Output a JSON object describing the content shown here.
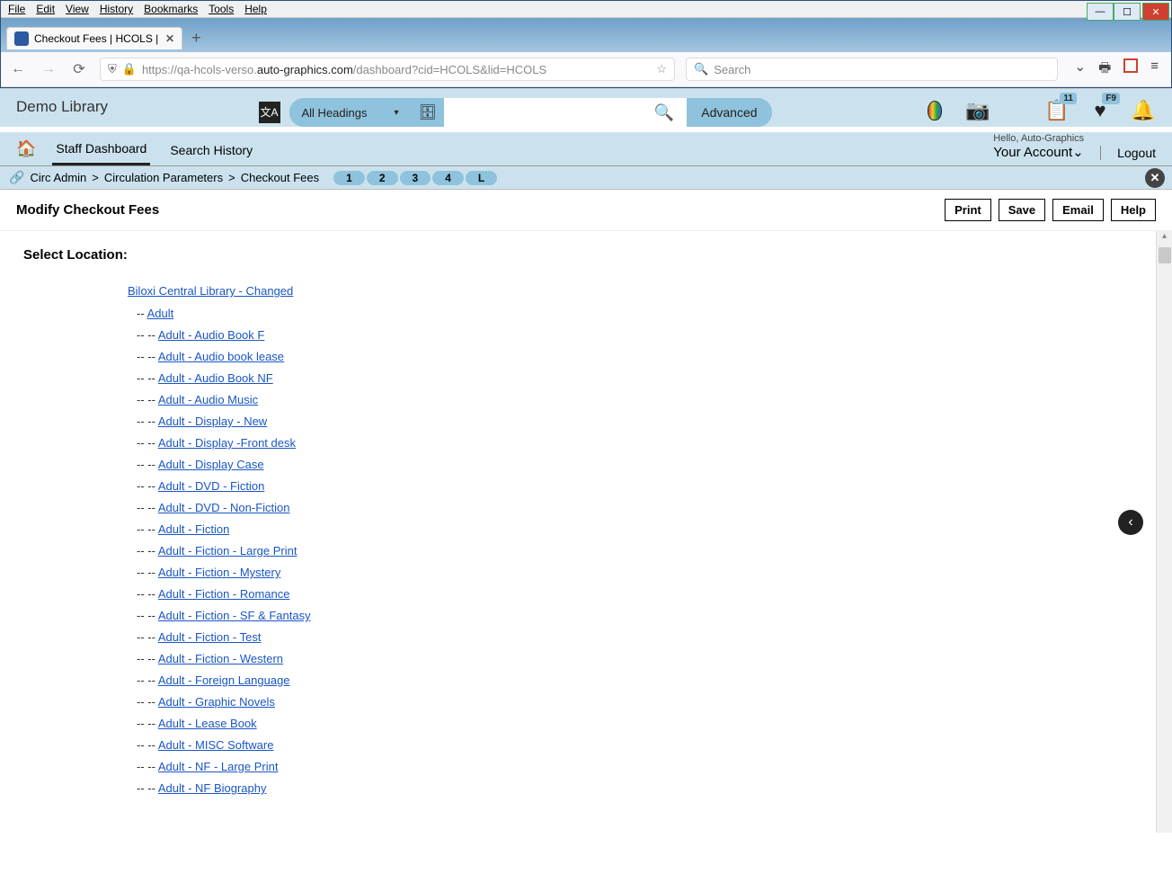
{
  "menubar": [
    "File",
    "Edit",
    "View",
    "History",
    "Bookmarks",
    "Tools",
    "Help"
  ],
  "tab": {
    "title": "Checkout Fees | HCOLS | hcols |"
  },
  "url": {
    "prefix": "https://qa-hcols-verso.",
    "bold": "auto-graphics.com",
    "suffix": "/dashboard?cid=HCOLS&lid=HCOLS"
  },
  "browser_search_placeholder": "Search",
  "header": {
    "library": "Demo Library",
    "dropdown": "All Headings",
    "advanced": "Advanced",
    "badges": {
      "list": "11",
      "fav": "F9"
    },
    "hello": "Hello, Auto-Graphics",
    "account": "Your Account",
    "logout": "Logout"
  },
  "nav": {
    "staff": "Staff Dashboard",
    "history": "Search History"
  },
  "breadcrumb": {
    "items": [
      "Circ Admin",
      "Circulation Parameters",
      "Checkout Fees"
    ],
    "steps": [
      "1",
      "2",
      "3",
      "4",
      "L"
    ]
  },
  "toolbar": {
    "title": "Modify Checkout Fees",
    "print": "Print",
    "save": "Save",
    "email": "Email",
    "help": "Help"
  },
  "section": {
    "label": "Select Location:",
    "root": "Biloxi Central Library - Changed",
    "level1": [
      {
        "label": "Adult"
      }
    ],
    "level2": [
      "Adult - Audio Book F",
      "Adult - Audio book lease",
      "Adult - Audio Book NF",
      "Adult - Audio Music",
      "Adult - Display - New",
      "Adult - Display -Front desk",
      "Adult - Display Case",
      "Adult - DVD - Fiction",
      "Adult - DVD - Non-Fiction",
      "Adult - Fiction",
      "Adult - Fiction - Large Print",
      "Adult - Fiction - Mystery",
      "Adult - Fiction - Romance",
      "Adult - Fiction - SF & Fantasy",
      "Adult - Fiction - Test",
      "Adult - Fiction - Western",
      "Adult - Foreign Language",
      "Adult - Graphic Novels",
      "Adult - Lease Book",
      "Adult - MISC Software",
      "Adult - NF - Large Print",
      "Adult - NF Biography"
    ]
  }
}
